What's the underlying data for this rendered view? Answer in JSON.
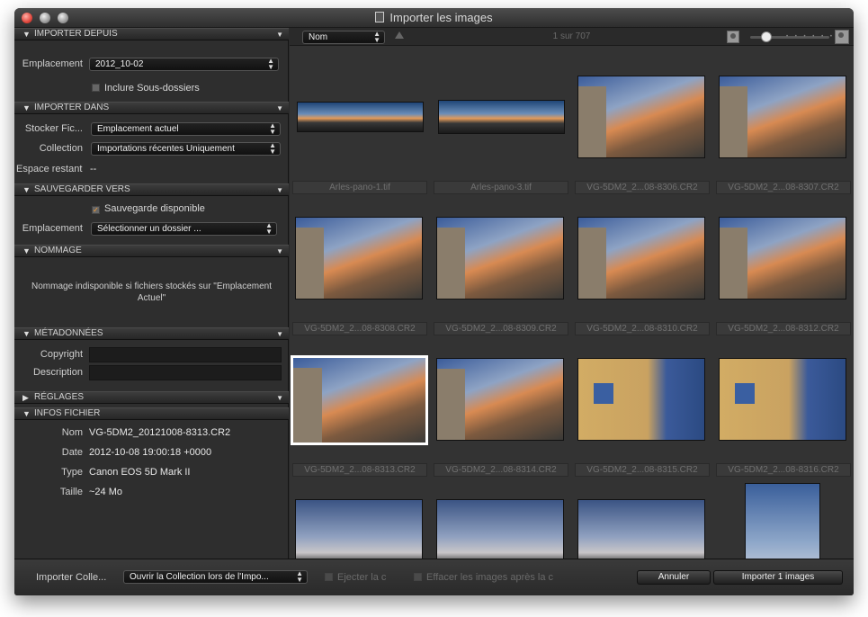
{
  "window": {
    "title": "Importer les images"
  },
  "sidebar": {
    "import_from": {
      "header": "IMPORTER DEPUIS",
      "location_label": "Emplacement",
      "location_value": "2012_10-02",
      "include_subfolders": "Inclure Sous-dossiers"
    },
    "import_into": {
      "header": "IMPORTER DANS",
      "store_label": "Stocker Fic...",
      "store_value": "Emplacement actuel",
      "collection_label": "Collection",
      "collection_value": "Importations récentes Uniquement",
      "space_label": "Espace restant",
      "space_value": "--"
    },
    "backup": {
      "header": "SAUVEGARDER VERS",
      "available": "Sauvegarde disponible",
      "location_label": "Emplacement",
      "location_value": "Sélectionner un dossier ..."
    },
    "naming": {
      "header": "NOMMAGE",
      "note_line1": "Nommage indisponible si fichiers stockés sur \"Emplacement",
      "note_line2": "Actuel\""
    },
    "metadata": {
      "header": "MÉTADONNÉES",
      "copyright_label": "Copyright",
      "copyright_value": "",
      "description_label": "Description",
      "description_value": ""
    },
    "settings": {
      "header": "RÉGLAGES"
    },
    "file_info": {
      "header": "INFOS FICHIER",
      "name_label": "Nom",
      "name_value": "VG-5DM2_20121008-8313.CR2",
      "date_label": "Date",
      "date_value": "2012-10-08 19:00:18 +0000",
      "type_label": "Type",
      "type_value": "Canon EOS 5D Mark II",
      "size_label": "Taille",
      "size_value": "~24 Mo"
    }
  },
  "browser": {
    "sort_value": "Nom",
    "counter": "1 sur 707",
    "thumbnails": [
      {
        "caption": "Arles-pano-1.tif"
      },
      {
        "caption": "Arles-pano-3.tif"
      },
      {
        "caption": "VG-5DM2_2...08-8306.CR2"
      },
      {
        "caption": "VG-5DM2_2...08-8307.CR2"
      },
      {
        "caption": "VG-5DM2_2...08-8308.CR2"
      },
      {
        "caption": "VG-5DM2_2...08-8309.CR2"
      },
      {
        "caption": "VG-5DM2_2...08-8310.CR2"
      },
      {
        "caption": "VG-5DM2_2...08-8312.CR2"
      },
      {
        "caption": "VG-5DM2_2...08-8313.CR2",
        "selected": true
      },
      {
        "caption": "VG-5DM2_2...08-8314.CR2"
      },
      {
        "caption": "VG-5DM2_2...08-8315.CR2"
      },
      {
        "caption": "VG-5DM2_2...08-8316.CR2"
      },
      {
        "caption": ""
      },
      {
        "caption": ""
      },
      {
        "caption": ""
      },
      {
        "caption": ""
      }
    ]
  },
  "footer": {
    "import_collection_label": "Importer Colle...",
    "import_collection_value": "Ouvrir la Collection lors de l'Impo...",
    "eject": "Ejecter la c",
    "erase": "Effacer les images après la c",
    "cancel": "Annuler",
    "import": "Importer 1 images"
  },
  "icons": {
    "section_toggle": "disclosure-triangle-icon",
    "section_menu": "section-menu-icon",
    "popup": "popup-arrows-icon",
    "zoom_small": "person-small-icon",
    "zoom_large": "person-large-icon"
  }
}
